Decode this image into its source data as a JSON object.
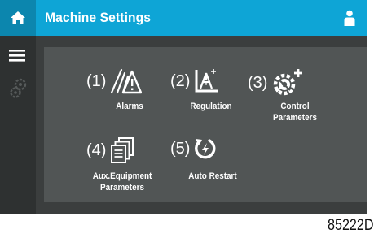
{
  "header": {
    "title": "Machine Settings"
  },
  "menu": [
    {
      "num": "(1)",
      "label": "Alarms",
      "icon": "alarm-triangle-icon"
    },
    {
      "num": "(2)",
      "label": "Regulation",
      "icon": "regulation-icon"
    },
    {
      "num": "(3)",
      "label": "Control Parameters",
      "icon": "gear-plus-icon"
    },
    {
      "num": "(4)",
      "label": "Aux.Equipment Parameters",
      "icon": "stacked-documents-icon"
    },
    {
      "num": "(5)",
      "label": "Auto Restart",
      "icon": "auto-restart-icon"
    }
  ],
  "label_lines": {
    "control1": "Control",
    "control2": "Parameters",
    "aux1": "Aux.Equipment",
    "aux2": "Parameters"
  },
  "footer": {
    "doc_id": "85222D"
  },
  "colors": {
    "header": "#0ea5d6",
    "home": "#0c86ae",
    "screen": "#3b3e3e",
    "panel": "#515555",
    "sidebar": "#2e3131"
  }
}
